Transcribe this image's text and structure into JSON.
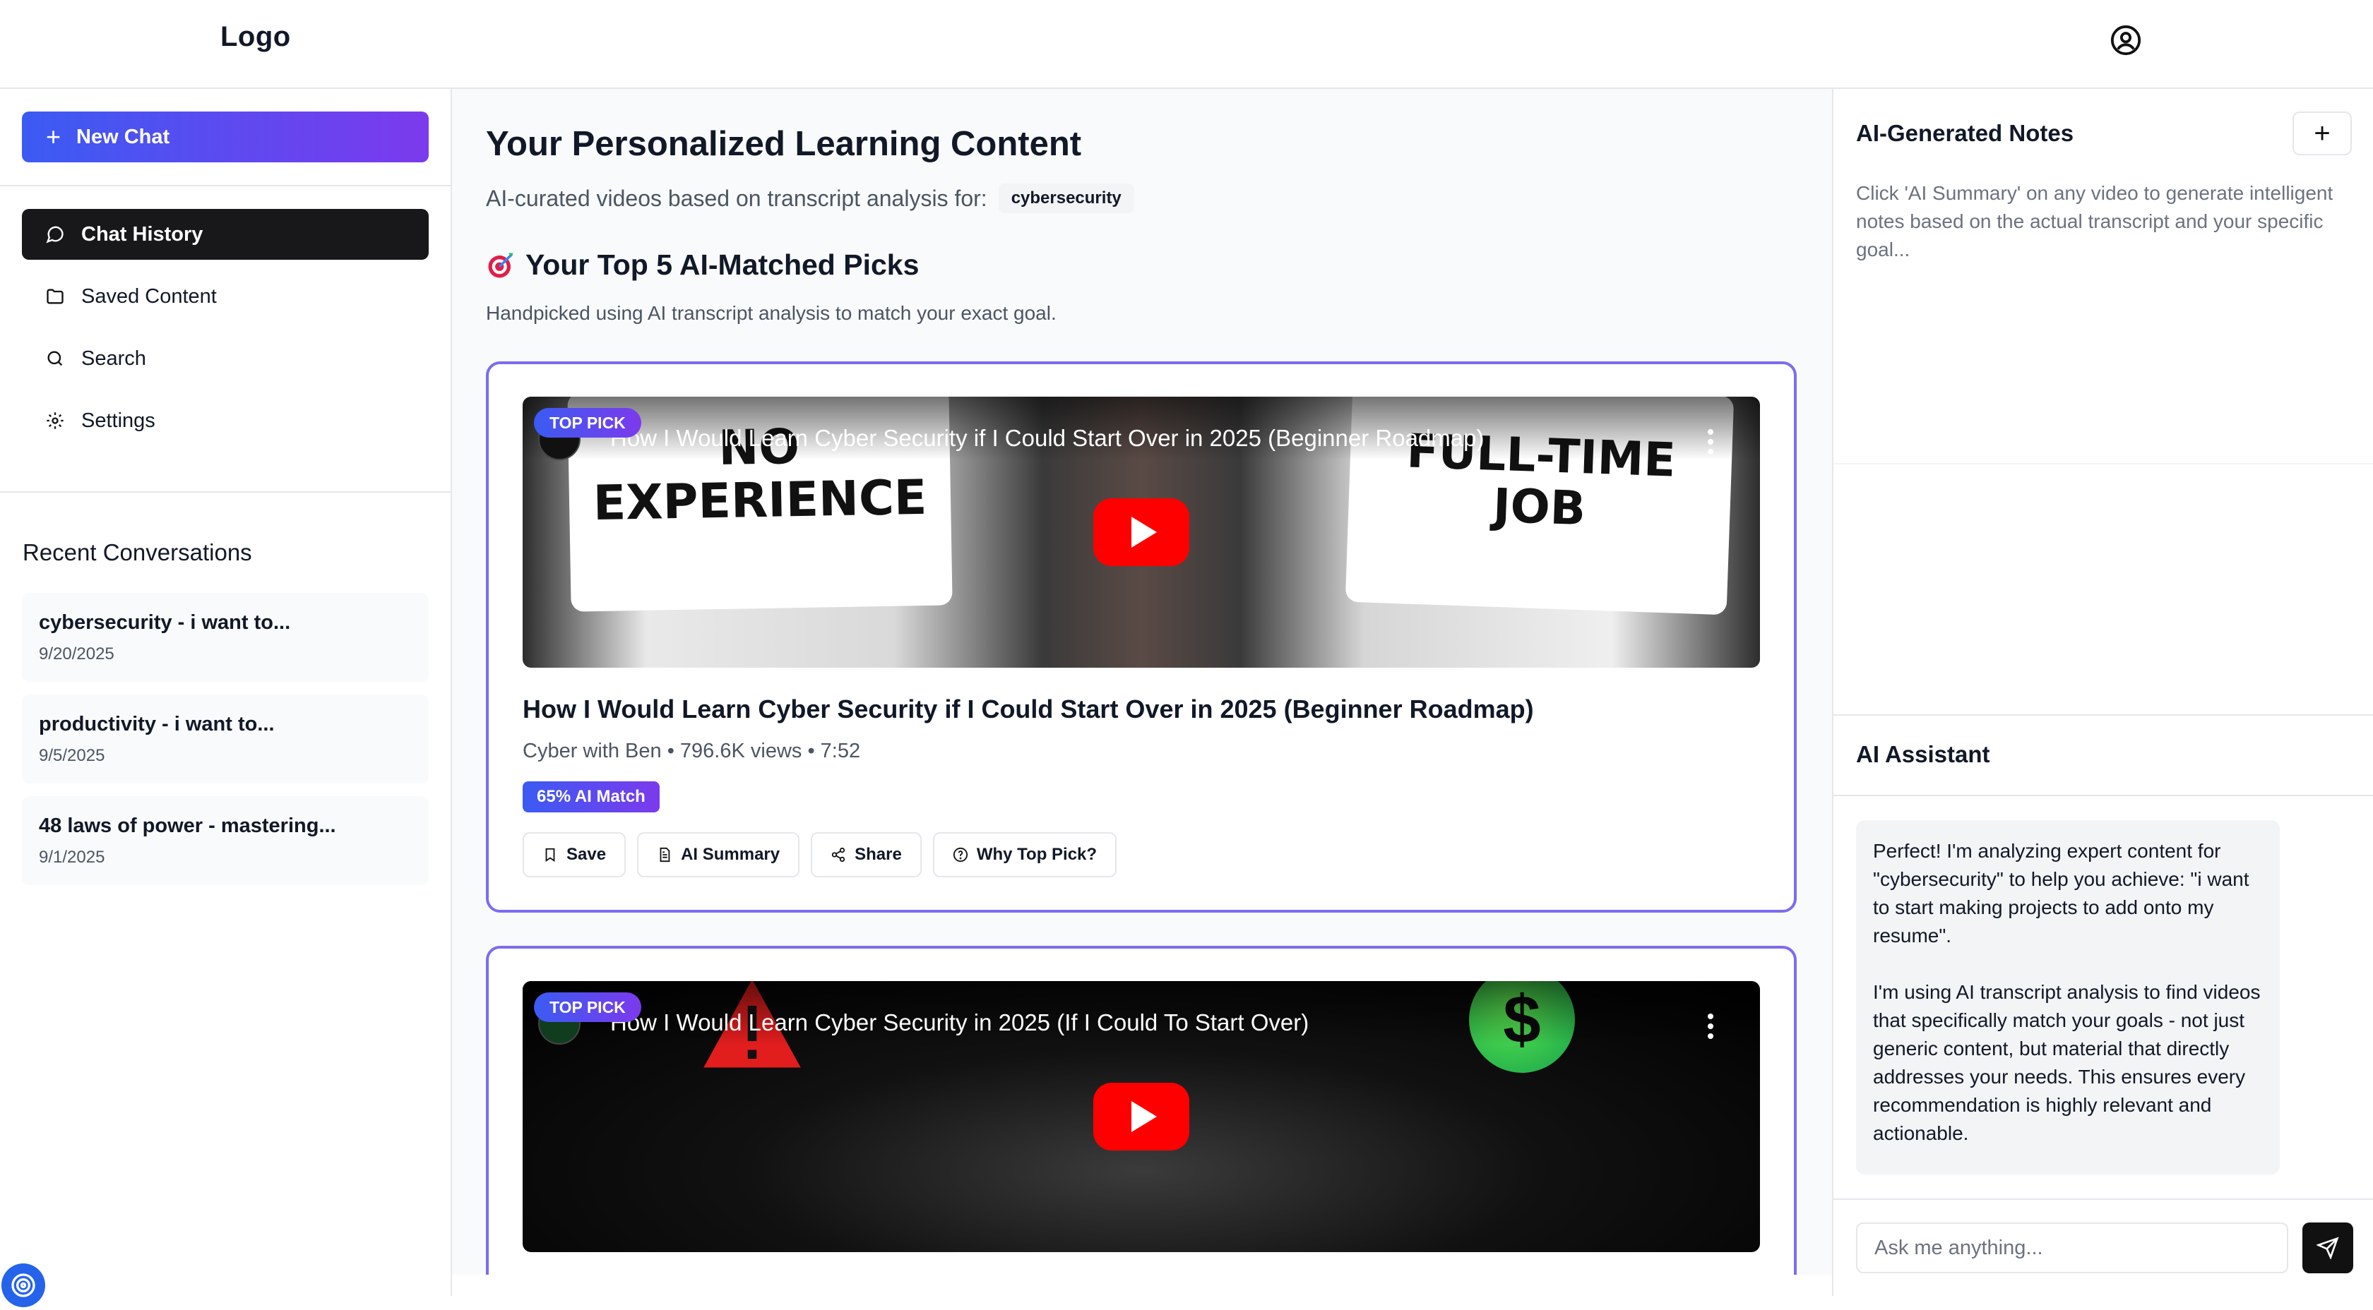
{
  "header": {
    "logo": "Logo",
    "account_icon": "user-circle-icon"
  },
  "sidebar": {
    "new_chat_label": "New Chat",
    "nav": [
      {
        "label": "Chat History",
        "icon": "message-circle-icon",
        "active": true
      },
      {
        "label": "Saved Content",
        "icon": "folder-icon",
        "active": false
      },
      {
        "label": "Search",
        "icon": "search-icon",
        "active": false
      },
      {
        "label": "Settings",
        "icon": "gear-icon",
        "active": false
      }
    ],
    "recent_title": "Recent Conversations",
    "recent": [
      {
        "title": "cybersecurity - i want to...",
        "date": "9/20/2025"
      },
      {
        "title": "productivity - i want to...",
        "date": "9/5/2025"
      },
      {
        "title": "48 laws of power - mastering...",
        "date": "9/1/2025"
      }
    ]
  },
  "main": {
    "title": "Your Personalized Learning Content",
    "subtitle": "AI-curated videos based on transcript analysis for:",
    "topic": "cybersecurity",
    "picks_title": "Your Top 5 AI-Matched Picks",
    "picks_subtitle": "Handpicked using AI transcript analysis to match your exact goal.",
    "badge_label": "TOP PICK",
    "videos": [
      {
        "embed_title": "How I Would Learn Cyber Security if I Could Start Over in 2025 (Beginner Roadmap)",
        "thumb_text_left": "NO EXPERIENCE",
        "thumb_text_right": "FULL-TIME JOB",
        "title": "How I Would Learn Cyber Security if I Could Start Over in 2025 (Beginner Roadmap)",
        "meta": "Cyber with Ben • 796.6K views • 7:52",
        "match": "65% AI Match",
        "actions": [
          "Save",
          "AI Summary",
          "Share",
          "Why Top Pick?"
        ]
      },
      {
        "embed_title": "How I Would Learn Cyber Security in 2025 (If I Could To Start Over)",
        "thumb_symbol": "$"
      }
    ]
  },
  "notes": {
    "title": "AI-Generated Notes",
    "hint": "Click 'AI Summary' on any video to generate intelligent notes based on the actual transcript and your specific goal..."
  },
  "assistant": {
    "title": "AI Assistant",
    "message": "Perfect! I'm analyzing expert content for \"cybersecurity\" to help you achieve: \"i want to start making projects to add onto my resume\".\n\nI'm using AI transcript analysis to find videos that specifically match your goals - not just generic content, but material that directly addresses your needs. This ensures every recommendation is highly relevant and actionable.",
    "input_placeholder": "Ask me anything..."
  },
  "colors": {
    "accent_start": "#3b5bf2",
    "accent_end": "#7c3aed",
    "play_red": "#ff0000"
  }
}
